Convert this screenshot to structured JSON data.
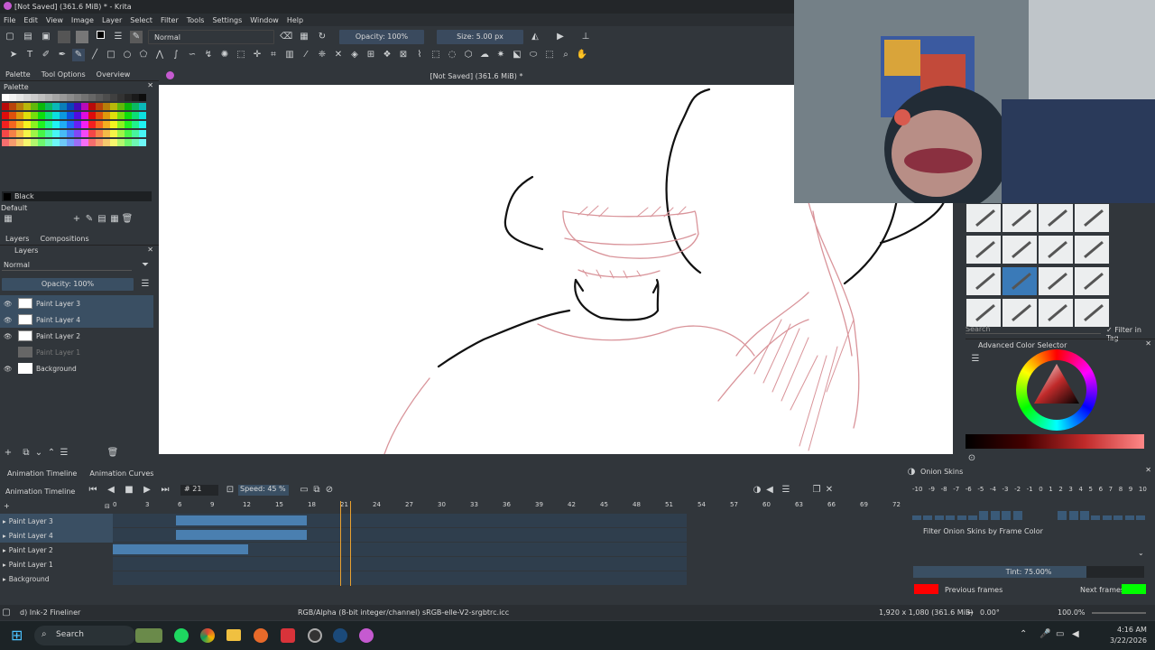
{
  "window": {
    "title": "[Not Saved]  (361.6 MiB) * - Krita"
  },
  "menu": [
    "File",
    "Edit",
    "View",
    "Image",
    "Layer",
    "Select",
    "Filter",
    "Tools",
    "Settings",
    "Window",
    "Help"
  ],
  "toolbar": {
    "blend_mode": "Normal",
    "opacity": "Opacity: 100%",
    "size": "Size: 5.00 px"
  },
  "canvas": {
    "header": "[Not Saved]  (361.6 MiB) *"
  },
  "left_tabs": [
    "Palette",
    "Tool Options",
    "Overview"
  ],
  "palette": {
    "title": "Palette",
    "color_name": "Black",
    "preset": "Default"
  },
  "layers_panel": {
    "tabs": [
      "Layers",
      "Compositions"
    ],
    "title": "Layers",
    "blend": "Normal",
    "opacity": "Opacity:  100%",
    "layers": [
      {
        "name": "Paint Layer 3",
        "selected": true
      },
      {
        "name": "Paint Layer 4",
        "selected": true
      },
      {
        "name": "Paint Layer 2",
        "selected": false
      },
      {
        "name": "Paint Layer 1",
        "selected": false
      },
      {
        "name": "Background",
        "selected": false
      }
    ]
  },
  "brush_panel": {
    "search": "Search",
    "filter_tag": "Filter in Tag"
  },
  "color_selector": {
    "title": "Advanced Color Selector"
  },
  "timeline": {
    "tabs": [
      "Animation Timeline",
      "Animation Curves"
    ],
    "title": "Animation Timeline",
    "frame": "21",
    "speed": "Speed: 45 %",
    "ruler": [
      "0",
      "3",
      "6",
      "9",
      "12",
      "15",
      "18",
      "21",
      "24",
      "27",
      "30",
      "33",
      "36",
      "39",
      "42",
      "45",
      "48",
      "51",
      "54",
      "57",
      "60",
      "63",
      "66",
      "69",
      "72"
    ],
    "layers": [
      "Paint Layer 3",
      "Paint Layer 4",
      "Paint Layer 2",
      "Paint Layer 1",
      "Background"
    ]
  },
  "onion": {
    "title": "Onion Skins",
    "numbers": [
      "-10",
      "-9",
      "-8",
      "-7",
      "-6",
      "-5",
      "-4",
      "-3",
      "-2",
      "-1",
      "0",
      "1",
      "2",
      "3",
      "4",
      "5",
      "6",
      "7",
      "8",
      "9",
      "10"
    ],
    "filter": "Filter Onion Skins by Frame Color",
    "tint": "Tint: 75.00%",
    "prev": "Previous frames",
    "next": "Next frames",
    "prev_color": "#ff0000",
    "next_color": "#00ff00"
  },
  "status": {
    "brush": "d) Ink-2 Fineliner",
    "color_model": "RGB/Alpha (8-bit integer/channel)  sRGB-elle-V2-srgbtrc.icc",
    "dimensions": "1,920 x 1,080 (361.6 MiB)",
    "rotation": "0.00°",
    "zoom": "100.0%"
  },
  "taskbar": {
    "search": "Search",
    "time": "4:16 AM",
    "date": "3/22/2026"
  }
}
